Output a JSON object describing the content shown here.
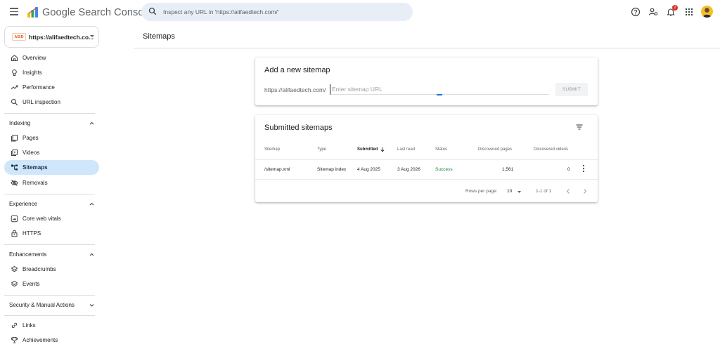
{
  "app": {
    "title": "Google Search Console"
  },
  "search": {
    "placeholder": "Inspect any URL in 'https://alifaedtech.com/'"
  },
  "header": {
    "notifications_count": "2"
  },
  "property": {
    "badge": "AISD",
    "name": "https://alifaedtech.co..."
  },
  "sidebar": {
    "top_items": [
      {
        "label": "Overview",
        "icon": "home-icon"
      },
      {
        "label": "Insights",
        "icon": "insights-icon"
      },
      {
        "label": "Performance",
        "icon": "trending-up-icon"
      },
      {
        "label": "URL inspection",
        "icon": "search-icon"
      }
    ],
    "indexing": {
      "title": "Indexing",
      "items": [
        {
          "label": "Pages",
          "icon": "pages-icon"
        },
        {
          "label": "Videos",
          "icon": "video-icon"
        },
        {
          "label": "Sitemaps",
          "icon": "sitemap-icon",
          "active": true
        },
        {
          "label": "Removals",
          "icon": "removals-icon"
        }
      ]
    },
    "experience": {
      "title": "Experience",
      "items": [
        {
          "label": "Core web vitals",
          "icon": "speed-icon"
        },
        {
          "label": "HTTPS",
          "icon": "lock-icon"
        }
      ]
    },
    "enhancements": {
      "title": "Enhancements",
      "items": [
        {
          "label": "Breadcrumbs",
          "icon": "layers-icon"
        },
        {
          "label": "Events",
          "icon": "layers-icon"
        }
      ]
    },
    "security": {
      "title": "Security & Manual Actions"
    },
    "bottom_items": [
      {
        "label": "Links",
        "icon": "link-icon"
      },
      {
        "label": "Achievements",
        "icon": "trophy-icon"
      }
    ]
  },
  "main": {
    "page_title": "Sitemaps",
    "add_card": {
      "title": "Add a new sitemap",
      "url_prefix": "https://alifaedtech.com/",
      "input_placeholder": "Enter sitemap URL",
      "submit_label": "SUBMIT"
    },
    "submitted_card": {
      "title": "Submitted sitemaps",
      "columns": [
        "Sitemap",
        "Type",
        "Submitted",
        "Last read",
        "Status",
        "Discovered pages",
        "Discovered videos"
      ],
      "sort_column": "Submitted",
      "rows": [
        {
          "sitemap": "/sitemap.xml",
          "type": "Sitemap index",
          "submitted": "4 Aug 2025",
          "last_read": "3 Aug 2026",
          "status": "Success",
          "discovered_pages": "1,561",
          "discovered_videos": "0"
        }
      ],
      "pagination": {
        "rows_per_page_label": "Rows per page:",
        "rows_per_page": "10",
        "range": "1-1 of 1"
      }
    }
  },
  "colors": {
    "active_nav": "#cfe6fb",
    "success": "#188038",
    "accent": "#1a73e8",
    "notification": "#d93025"
  }
}
